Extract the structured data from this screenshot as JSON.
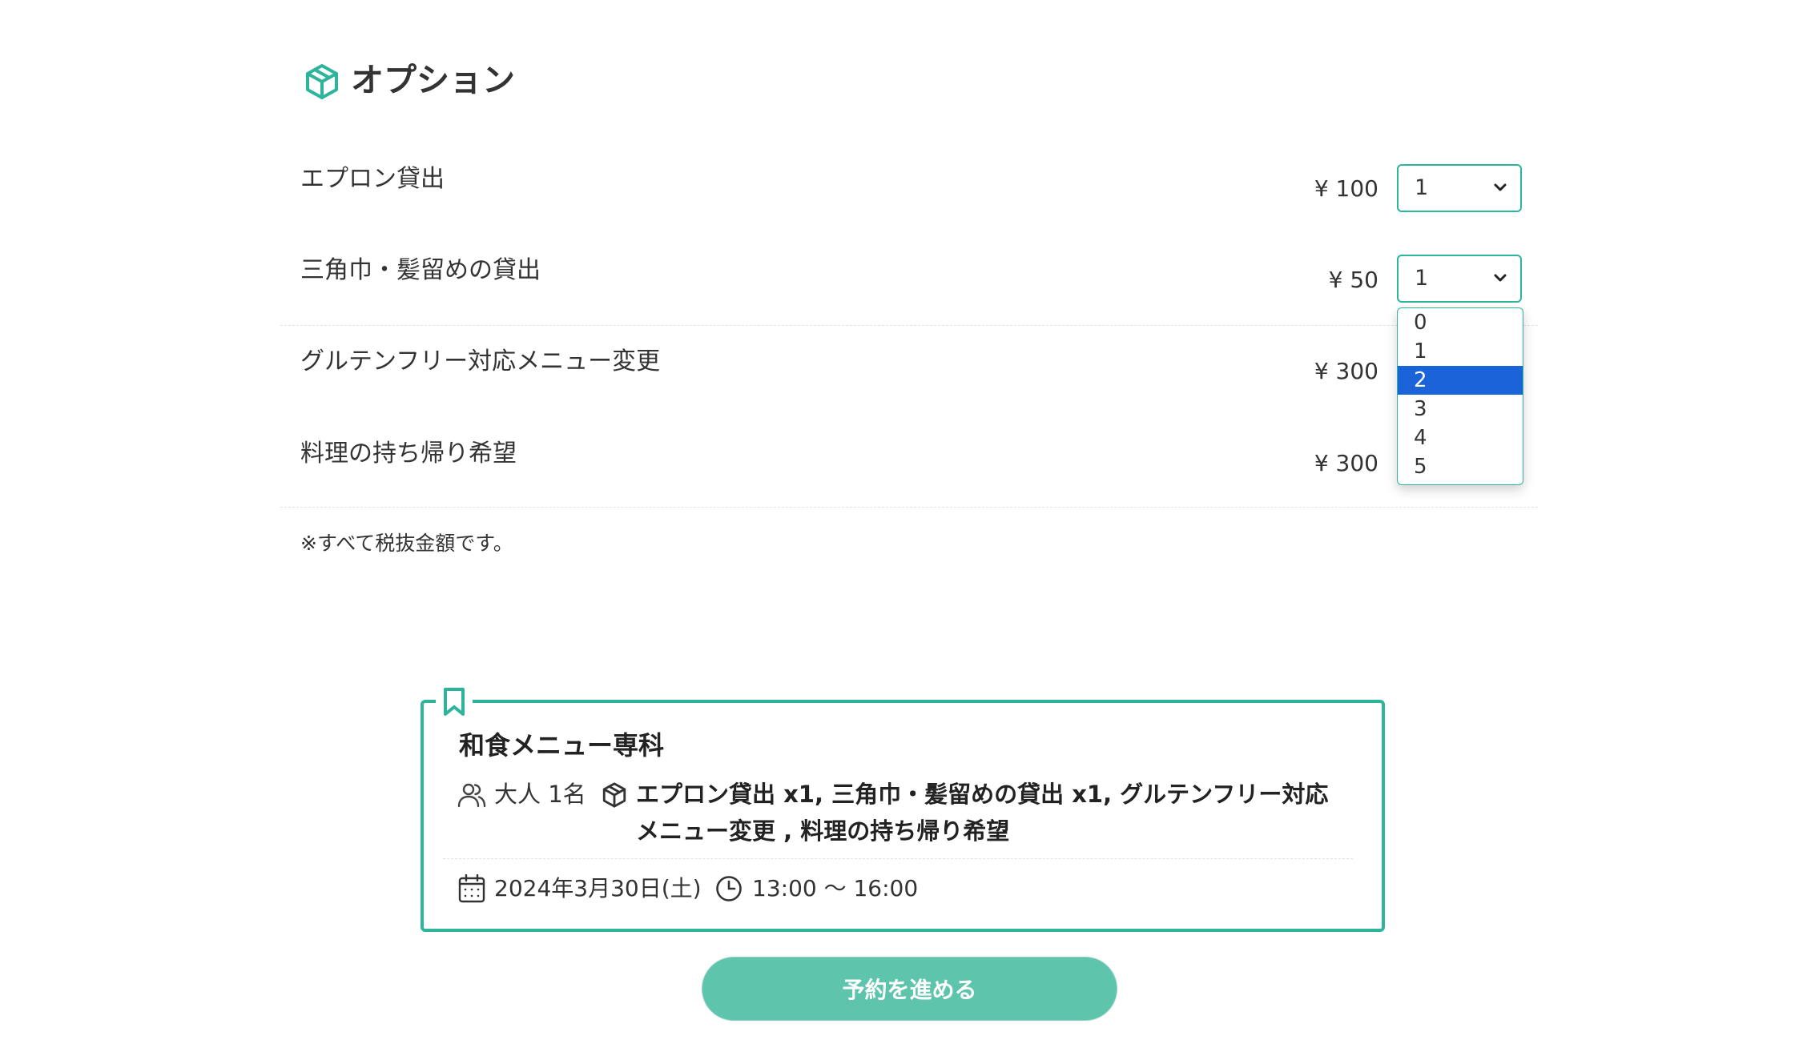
{
  "section": {
    "title": "オプション",
    "icon": "box-icon",
    "accent_color": "#2cb59a"
  },
  "options": [
    {
      "name": "エプロン貸出",
      "price": "¥ 100",
      "quantity": "1"
    },
    {
      "name": "三角巾・髪留めの貸出",
      "price": "¥ 50",
      "quantity": "1"
    },
    {
      "name": "グルテンフリー対応メニュー変更",
      "price": "¥ 300"
    },
    {
      "name": "料理の持ち帰り希望",
      "price": "¥ 300"
    }
  ],
  "dropdown": {
    "open_for": "三角巾・髪留めの貸出",
    "items": [
      "0",
      "1",
      "2",
      "3",
      "4",
      "5"
    ],
    "highlighted": "2",
    "highlight_color": "#1b63d8"
  },
  "note": "※すべて税抜金額です。",
  "summary": {
    "title": "和食メニュー専科",
    "people": "大人 1名",
    "options_line1": "エプロン貸出 x1, 三角巾・髪留めの貸出 x1, グルテンフリー対応",
    "options_line2": "メニュー変更 , 料理の持ち帰り希望",
    "date": "2024年3月30日(土)",
    "time": "13:00 〜 16:00"
  },
  "proceed_button": {
    "label": "予約を進める",
    "color": "#5ec4ac"
  }
}
